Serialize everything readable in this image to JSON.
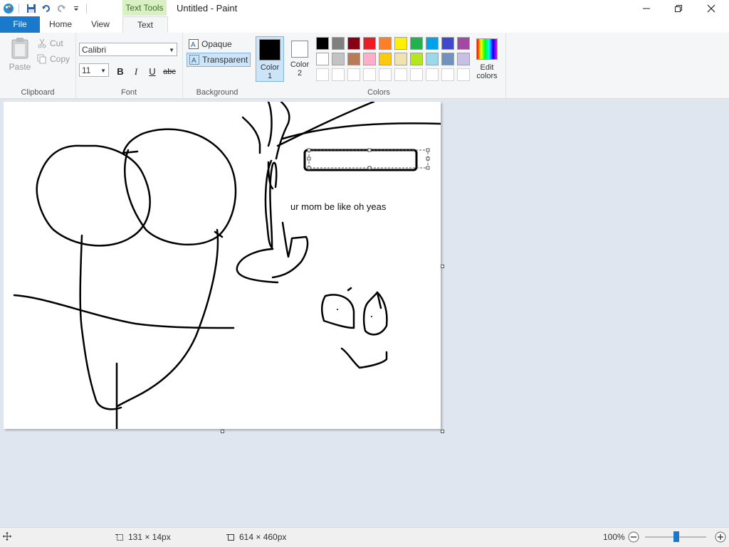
{
  "window": {
    "title": "Untitled - Paint",
    "context_tab": "Text Tools",
    "controls": [
      "minimize",
      "maximize",
      "close"
    ]
  },
  "tabs": [
    {
      "label": "File"
    },
    {
      "label": "Home"
    },
    {
      "label": "View"
    },
    {
      "label": "Text"
    }
  ],
  "ribbon": {
    "clipboard": {
      "label": "Clipboard",
      "paste": "Paste",
      "cut": "Cut",
      "copy": "Copy"
    },
    "font": {
      "label": "Font",
      "family": "Calibri",
      "size": "11",
      "bold": "B",
      "italic": "I",
      "underline": "U",
      "strike": "abc"
    },
    "background": {
      "label": "Background",
      "opaque": "Opaque",
      "transparent": "Transparent"
    },
    "colors": {
      "label": "Colors",
      "color1_label": "Color",
      "color1_num": "1",
      "color2_label": "Color",
      "color2_num": "2",
      "color1": "#000000",
      "color2": "#ffffff",
      "edit_label": "Edit",
      "edit_label2": "colors",
      "palette_row1": [
        "#000000",
        "#7f7f7f",
        "#880015",
        "#ed1c24",
        "#ff7f27",
        "#fff200",
        "#22b14c",
        "#00a2e8",
        "#3f48cc",
        "#a349a4"
      ],
      "palette_row2": [
        "#ffffff",
        "#c3c3c3",
        "#b97a57",
        "#ffaec9",
        "#ffc90e",
        "#efe4b0",
        "#b5e61d",
        "#99d9ea",
        "#7092be",
        "#c8bfe7"
      ],
      "palette_row3": [
        "#ffffff",
        "#ffffff",
        "#ffffff",
        "#ffffff",
        "#ffffff",
        "#ffffff",
        "#ffffff",
        "#ffffff",
        "#ffffff",
        "#ffffff"
      ]
    }
  },
  "canvas": {
    "text": "ur mom be like oh yeas"
  },
  "statusbar": {
    "selection_size": "131 × 14px",
    "canvas_size": "614 × 460px",
    "zoom": "100%"
  }
}
